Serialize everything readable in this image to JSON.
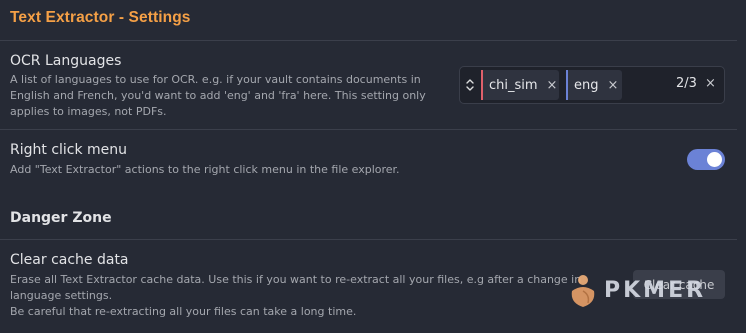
{
  "header": {
    "title": "Text Extractor - Settings"
  },
  "ocr_languages": {
    "name": "OCR Languages",
    "description_lines": [
      "A list of languages to use for OCR. e.g. if your vault contains documents in",
      "English and French, you'd want to add 'eng' and 'fra' here. This setting only",
      "applies to images, not PDFs."
    ],
    "chips": [
      {
        "label": "chi_sim",
        "accent": "#e0606b"
      },
      {
        "label": "eng",
        "accent": "#6b82d6"
      }
    ],
    "count": "2/3",
    "remove_glyph": "×",
    "clear_glyph": "×"
  },
  "right_click": {
    "name": "Right click menu",
    "description": "Add \"Text Extractor\" actions to the right click menu in the file explorer.",
    "enabled": true
  },
  "danger_zone": {
    "title": "Danger Zone"
  },
  "clear_cache": {
    "name": "Clear cache data",
    "description_lines": [
      "Erase all Text Extractor cache data. Use this if you want to re-extract all your files, e.g after a change in",
      "language settings.",
      "Be careful that re-extracting all your files can take a long time."
    ],
    "button_label": "Clear cache"
  },
  "watermark": {
    "text": "PKMER"
  },
  "colors": {
    "background": "#262a35",
    "accent_orange": "#f5a046",
    "toggle_on": "#6b82d6"
  }
}
